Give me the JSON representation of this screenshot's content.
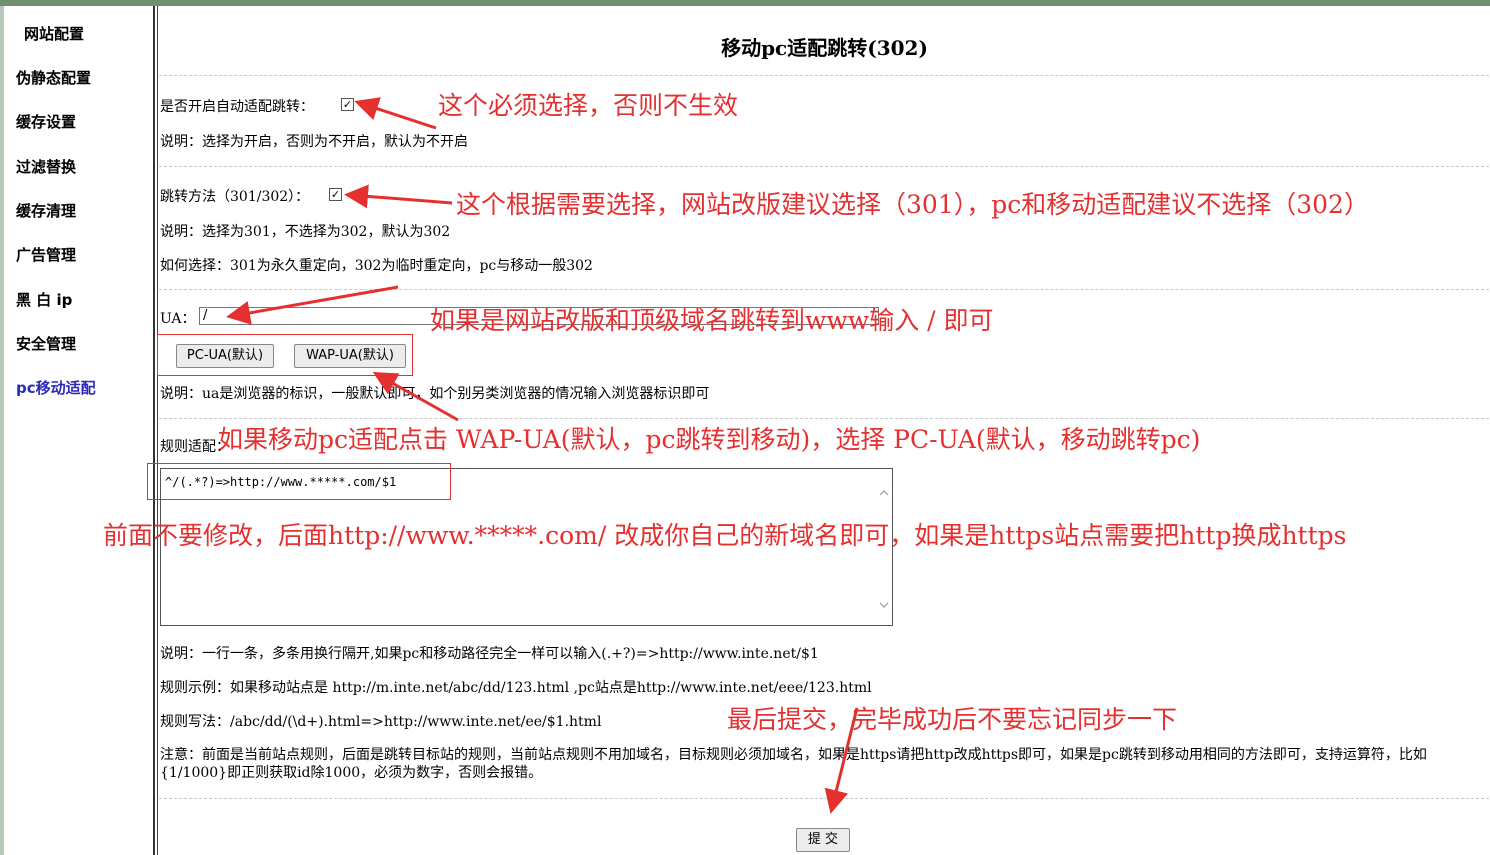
{
  "sidebar": {
    "items": [
      {
        "label": "网站配置"
      },
      {
        "label": "伪静态配置"
      },
      {
        "label": "缓存设置"
      },
      {
        "label": "过滤替换"
      },
      {
        "label": "缓存清理"
      },
      {
        "label": "广告管理"
      },
      {
        "label": "黑 白 ip"
      },
      {
        "label": "安全管理"
      },
      {
        "label": "pc移动适配",
        "active": true
      }
    ]
  },
  "page": {
    "title": "移动pc适配跳转(302)"
  },
  "form": {
    "auto_redirect_label": "是否开启自动适配跳转：",
    "auto_redirect_checked": true,
    "auto_redirect_desc": "说明：选择为开启，否则为不开启，默认为不开启",
    "method_label": "跳转方法（301/302）：",
    "method_checked": true,
    "method_desc": "说明：选择为301，不选择为302，默认为302",
    "method_howto": "如何选择：301为永久重定向，302为临时重定向，pc与移动一般302",
    "ua_label": "UA：",
    "ua_value": "/",
    "pc_ua_button": "PC-UA(默认)",
    "wap_ua_button": "WAP-UA(默认)",
    "ua_desc": "说明：ua是浏览器的标识，一般默认即可，如个别另类浏览器的情况输入浏览器标识即可",
    "rules_label": "规则适配：",
    "rules_value": "^/(.*?)=>http://www.*****.com/$1",
    "rules_desc": "说明：一行一条，多条用换行隔开,如果pc和移动路径完全一样可以输入(.+?)=>http://www.inte.net/$1",
    "rules_example": "规则示例：如果移动站点是 http://m.inte.net/abc/dd/123.html ,pc站点是http://www.inte.net/eee/123.html",
    "rules_syntax": "规则写法：/abc/dd/(\\d+).html=>http://www.inte.net/ee/$1.html",
    "notice": "注意：前面是当前站点规则，后面是跳转目标站的规则，当前站点规则不用加域名，目标规则必须加域名，如果是https请把http改成https即可，如果是pc跳转到移动用相同的方法即可，支持运算符，比如 {1/1000}即正则获取id除1000，必须为数字，否则会报错。",
    "submit_button": "提 交"
  },
  "annotations": {
    "a1": "这个必须选择，否则不生效",
    "a2": "这个根据需要选择，网站改版建议选择（301），pc和移动适配建议不选择（302）",
    "a3": "如果是网站改版和顶级域名跳转到www输入 / 即可",
    "a4": "如果移动pc适配点击 WAP-UA(默认，pc跳转到移动)，选择 PC-UA(默认，移动跳转pc)",
    "a5": "前面不要修改，后面http://www.*****.com/ 改成你自己的新域名即可，如果是https站点需要把http换成https",
    "a6": "最后提交，完毕成功后不要忘记同步一下",
    "color": "#e53030"
  },
  "colors": {
    "active_nav": "#2b2bb8",
    "topbar": "#6f8f6f"
  }
}
